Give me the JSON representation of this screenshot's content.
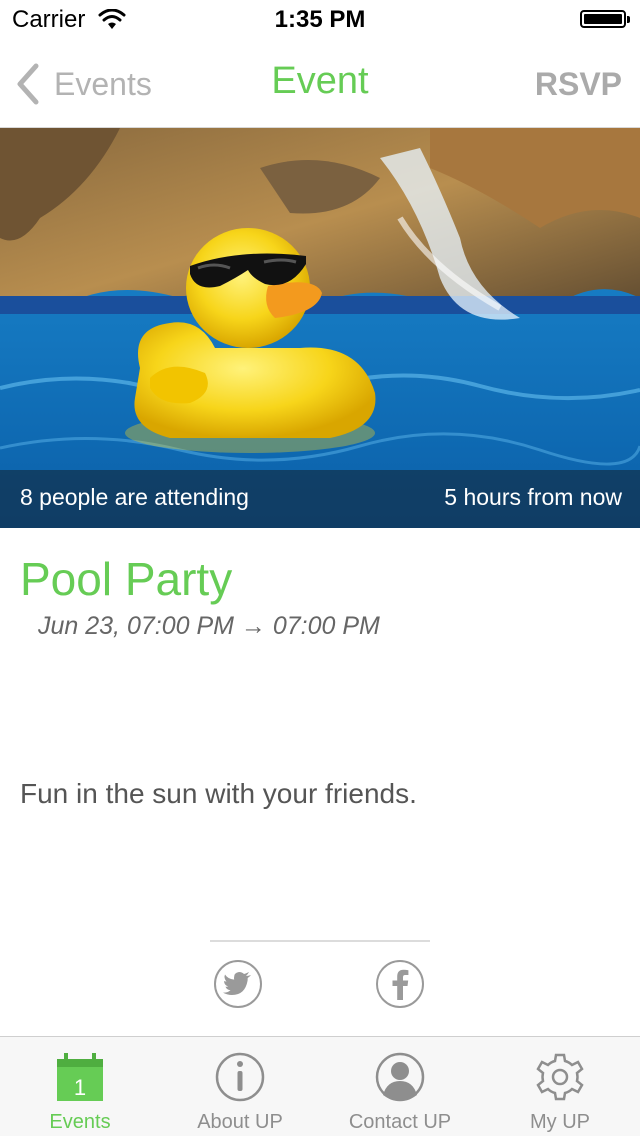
{
  "status_bar": {
    "carrier": "Carrier",
    "time": "1:35 PM"
  },
  "nav": {
    "back_label": "Events",
    "title": "Event",
    "rsvp_label": "RSVP"
  },
  "hero": {
    "image_icon": "rubber-duck-photo",
    "attending_text": "8 people are attending",
    "time_text": "5 hours from now"
  },
  "event": {
    "title": "Pool Party",
    "date_range": "Jun 23, 07:00 PM → 07:00 PM",
    "description": "Fun in the sun with your friends."
  },
  "social": {
    "twitter_icon": "twitter-icon",
    "facebook_icon": "facebook-icon"
  },
  "tabs": [
    {
      "label": "Events",
      "icon": "calendar-icon",
      "day": "1",
      "active": true
    },
    {
      "label": "About UP",
      "icon": "info-icon"
    },
    {
      "label": "Contact UP",
      "icon": "person-icon"
    },
    {
      "label": "My UP",
      "icon": "gear-icon"
    }
  ],
  "colors": {
    "accent": "#66cc55",
    "inactive": "#8e8e8e"
  }
}
